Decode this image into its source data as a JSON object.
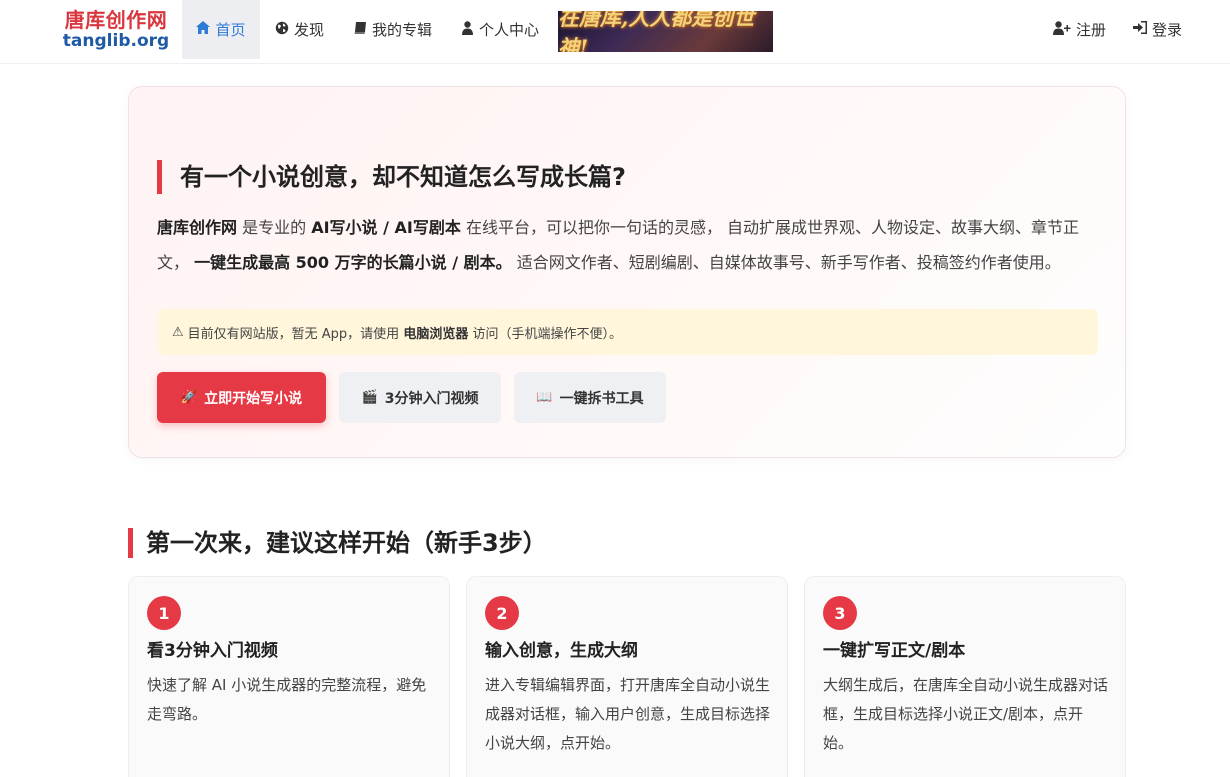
{
  "header": {
    "brand_cn": "唐库创作网",
    "brand_en": "tanglib.org",
    "nav": [
      {
        "label": "首页",
        "icon": "home-icon"
      },
      {
        "label": "发现",
        "icon": "globe-icon"
      },
      {
        "label": "我的专辑",
        "icon": "book-icon"
      },
      {
        "label": "个人中心",
        "icon": "user-icon"
      }
    ],
    "banner_text": "在唐库,人人都是创世神!",
    "register_label": "注册",
    "login_label": "登录",
    "active_color": "#2e7bd6"
  },
  "hero": {
    "title": "有一个小说创意，却不知道怎么写成长篇?",
    "desc": {
      "p1_bold": "唐库创作网",
      "p2": " 是专业的 ",
      "p3_bold": "AI写小说 / AI写剧本",
      "p4": " 在线平台，可以把你一句话的灵感， 自动扩展成世界观、人物设定、故事大纲、章节正文， ",
      "p5_bold": "一键生成最高 500 万字的长篇小说 / 剧本。",
      "p6": " 适合网文作者、短剧编剧、自媒体故事号、新手写作者、投稿签约作者使用。"
    },
    "notice": {
      "icon": "⚠",
      "text1": "目前仅有网站版，暂无 App，请使用 ",
      "text2_bold": "电脑浏览器",
      "text3": " 访问（手机端操作不便）。"
    },
    "buttons": {
      "primary_icon": "🚀",
      "primary_label": "立即开始写小说",
      "video_icon": "🎬",
      "video_label": "3分钟入门视频",
      "tool_icon": "📖",
      "tool_label": "一键拆书工具"
    },
    "accent_color": "#e63946"
  },
  "steps": {
    "title": "第一次来，建议这样开始（新手3步）",
    "items": [
      {
        "num": "1",
        "title": "看3分钟入门视频",
        "text": "快速了解 AI 小说生成器的完整流程，避免走弯路。"
      },
      {
        "num": "2",
        "title": "输入创意，生成大纲",
        "text": "进入专辑编辑界面，打开唐库全自动小说生成器对话框，输入用户创意，生成目标选择小说大纲，点开始。"
      },
      {
        "num": "3",
        "title": "一键扩写正文/剧本",
        "text": "大纲生成后，在唐库全自动小说生成器对话框，生成目标选择小说正文/剧本，点开始。"
      }
    ]
  }
}
